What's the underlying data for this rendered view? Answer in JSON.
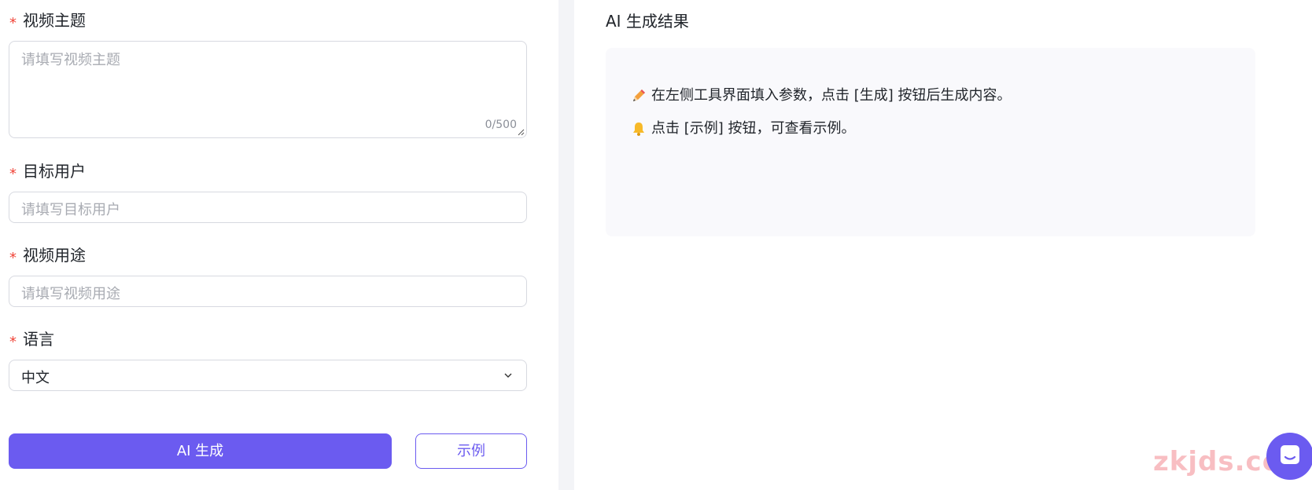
{
  "form": {
    "topic": {
      "required_mark": "*",
      "label": "视频主题",
      "placeholder": "请填写视频主题",
      "counter": "0/500"
    },
    "audience": {
      "required_mark": "*",
      "label": "目标用户",
      "placeholder": "请填写目标用户"
    },
    "purpose": {
      "required_mark": "*",
      "label": "视频用途",
      "placeholder": "请填写视频用途"
    },
    "language": {
      "required_mark": "*",
      "label": "语言",
      "value": "中文"
    },
    "generate_button": "AI 生成",
    "example_button": "示例"
  },
  "result": {
    "title": "AI 生成结果",
    "tips": [
      {
        "icon": "pencil-icon",
        "text": "在左侧工具界面填入参数，点击 [生成] 按钮后生成内容。"
      },
      {
        "icon": "bell-icon",
        "text": "点击 [示例] 按钮，可查看示例。"
      }
    ]
  },
  "watermark": "zkjds.com",
  "colors": {
    "accent": "#6b5bf0",
    "required": "#f04438",
    "placeholder": "#a8abb2",
    "result_bg": "#f9f9fc",
    "page_bg": "#f3f4f7"
  }
}
